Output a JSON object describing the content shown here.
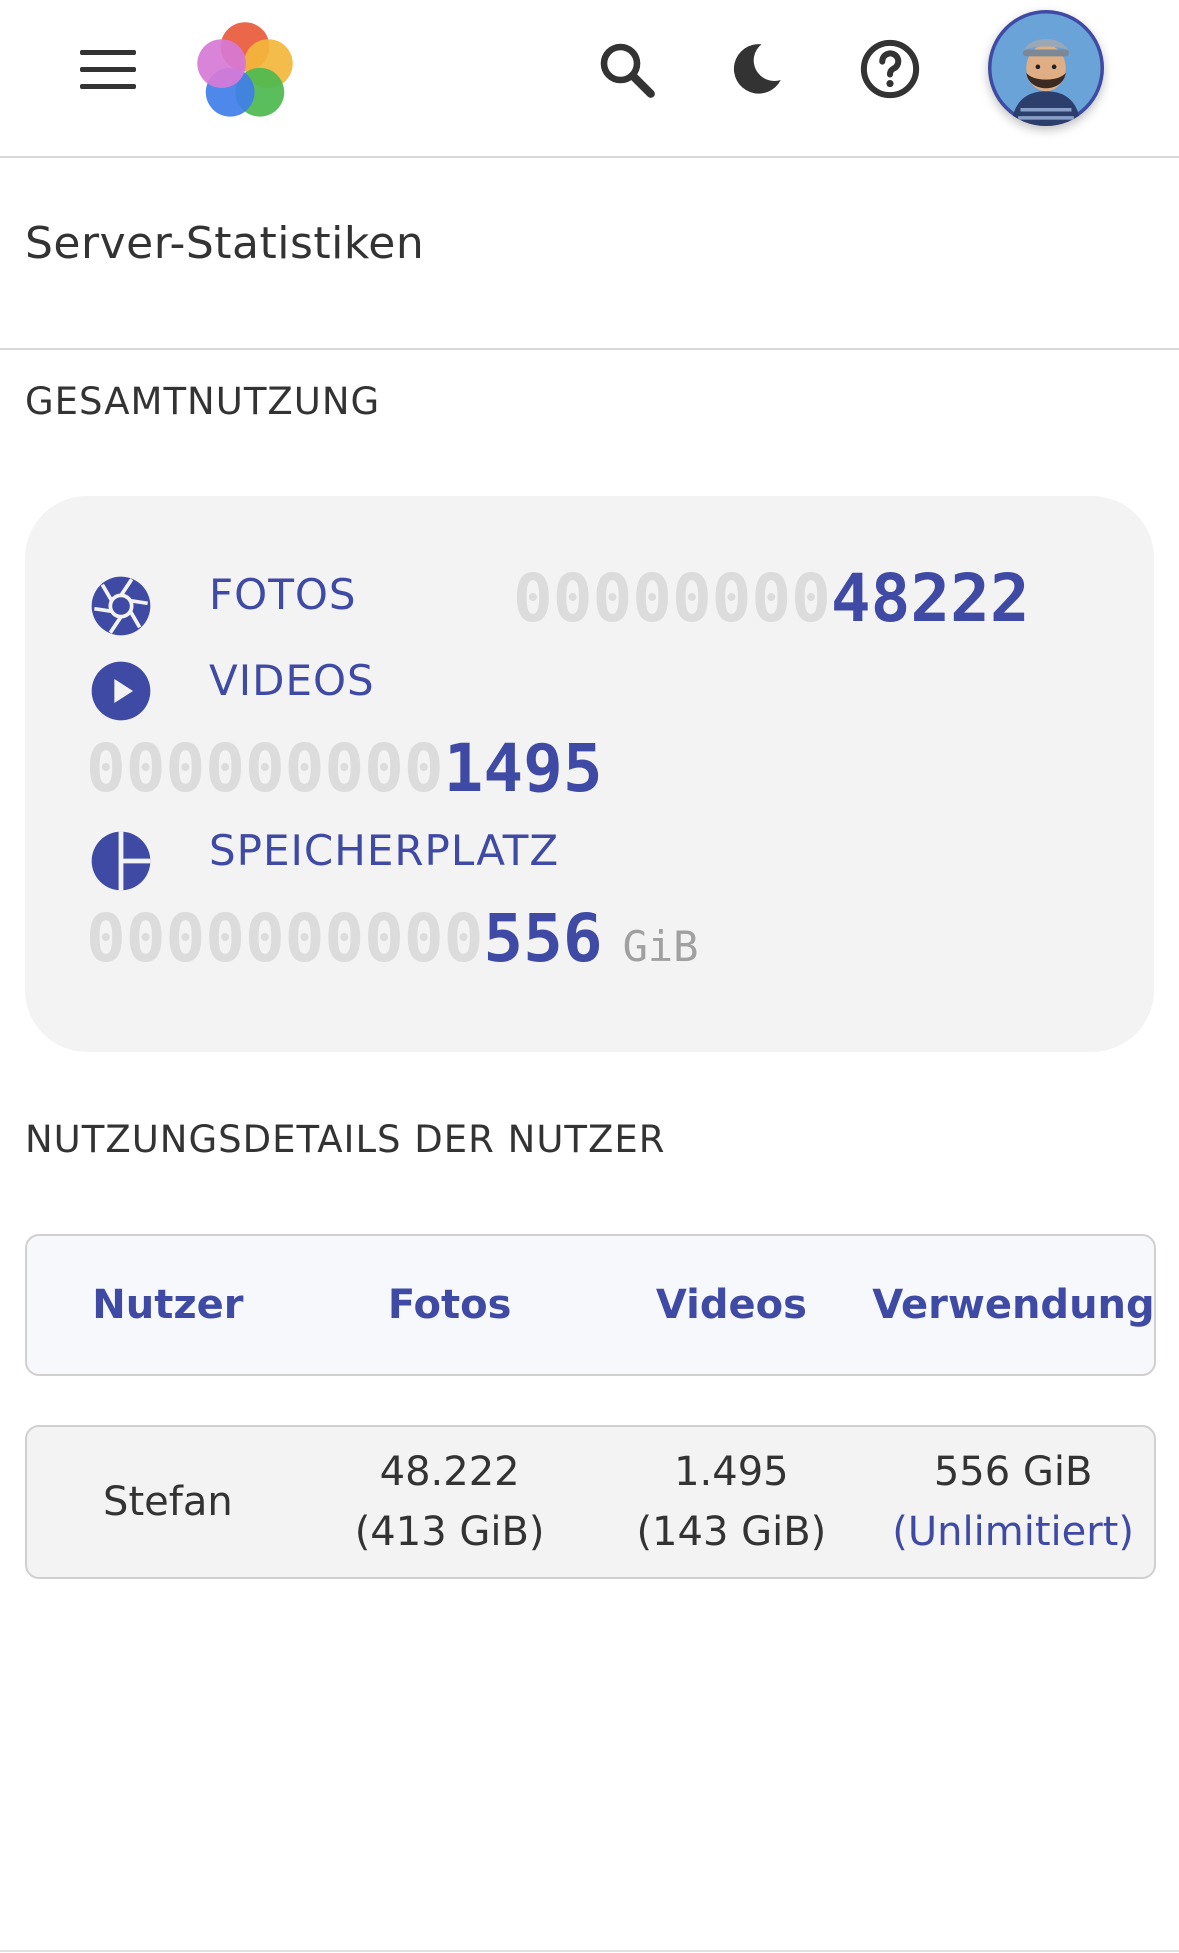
{
  "header": {
    "menu_icon": "hamburger-menu-icon",
    "logo_icon": "app-logo-icon",
    "search_icon": "search-icon",
    "theme_icon": "moon-icon",
    "help_icon": "help-circle-icon",
    "avatar_icon": "user-avatar"
  },
  "page": {
    "title": "Server-Statistiken"
  },
  "overall": {
    "heading": "GESAMTNUTZUNG",
    "photos": {
      "label": "FOTOS",
      "padding": "00000000",
      "value": "48222",
      "icon": "aperture-icon"
    },
    "videos": {
      "label": "VIDEOS",
      "padding": "000000000",
      "value": "1495",
      "icon": "play-circle-icon"
    },
    "storage": {
      "label": "SPEICHERPLATZ",
      "padding": "0000000000",
      "value": "556",
      "unit": "GiB",
      "icon": "pie-chart-icon"
    }
  },
  "user_usage": {
    "heading": "NUTZUNGSDETAILS DER NUTZER",
    "columns": [
      "Nutzer",
      "Fotos",
      "Videos",
      "Verwendung"
    ],
    "rows": [
      {
        "user": "Stefan",
        "photos": "48.222 (413 GiB)",
        "videos": "1.495 (143 GiB)",
        "usage": "556 GiB",
        "limit": "(Unlimitiert)"
      }
    ]
  },
  "colors": {
    "accent": "#3f4aa4",
    "text": "#333333",
    "card_bg": "#f3f3f3",
    "counter_padding": "#dcdcdc"
  }
}
